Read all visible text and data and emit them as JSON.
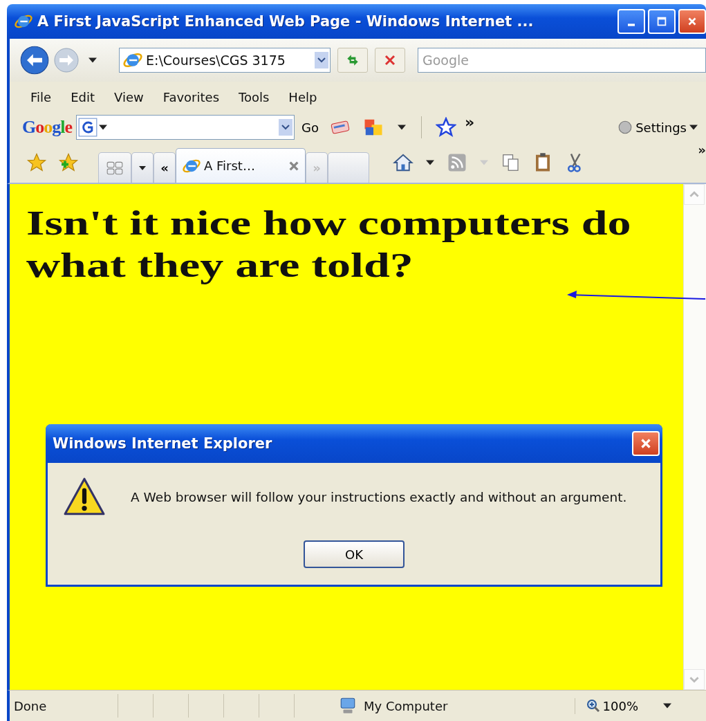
{
  "window": {
    "title": "A First JavaScript Enhanced Web Page - Windows Internet ..."
  },
  "address_bar": {
    "value": "E:\\Courses\\CGS 3175"
  },
  "search_field": {
    "placeholder": "Google"
  },
  "menu": [
    "File",
    "Edit",
    "View",
    "Favorites",
    "Tools",
    "Help"
  ],
  "google_toolbar": {
    "logo": "Google",
    "go": "Go",
    "more": "»",
    "settings": "Settings"
  },
  "tab_bar": {
    "scroll_left": "«",
    "tabs": [
      {
        "label": "A First…",
        "selected": true
      }
    ],
    "scroll_right": "»",
    "more": "»"
  },
  "page": {
    "heading": "Isn't it nice how computers do what they are told?"
  },
  "dialog": {
    "title": "Windows Internet Explorer",
    "message": "A Web browser will follow your instructions exactly and without an argument.",
    "button": "OK"
  },
  "status_bar": {
    "status": "Done",
    "zone": "My Computer",
    "zoom": "100%"
  }
}
